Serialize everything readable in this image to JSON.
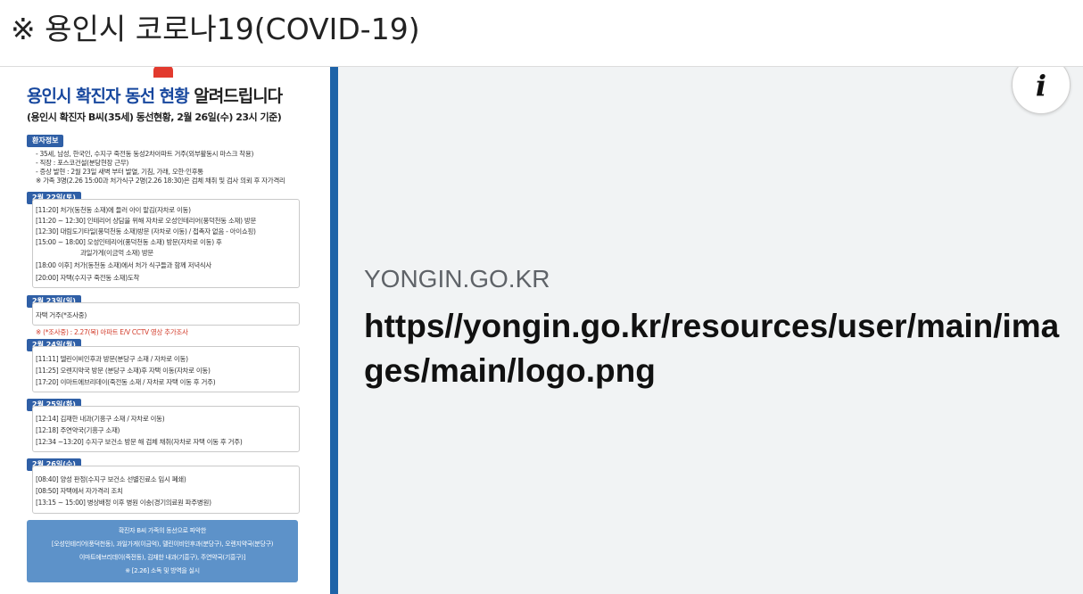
{
  "header": {
    "title": "※ 용인시 코로나19(COVID-19)"
  },
  "card": {
    "domain": "YONGIN.GO.KR",
    "url": "https//yongin.go.kr/resources/user/main/images/main/logo.png",
    "info_icon": "i"
  },
  "poster": {
    "title_blue": "용인시 확진자 동선 현황",
    "title_dark": "알려드립니다",
    "subtitle": "(용인시 확진자 B씨(35세) 동선현황, 2월 26일(수) 23시 기준)",
    "sections": {
      "s0": {
        "head": "환자정보",
        "lines": [
          "- 35세, 남성, 한국인, 수지구 죽전동 동성2차아파트 거주(외부활동시 마스크 착용)",
          "- 직장 : 포스코건설(분당현장 근무)",
          "- 증상 발현 : 2월 23일 새벽 부터 발열, 기침, 가래, 오한·인후통",
          "※ 가족 3명(2.26 15:00과 처가식구 2명(2.26 18:30)은 검체 채취 및 검사 의뢰 후 자가격리"
        ]
      },
      "s1": {
        "head": "2월 22일(토)",
        "lines": [
          "[11:20] 처가(동천동 소재)에 들러 아이 맡김(자차로 이동)",
          "[11:20 ~ 12:30] 인테리어 상담을 위해 자차로 오성인테리어(풍덕천동 소재) 방문",
          "[12:30] 대림도기타일(풍덕천동 소재)방문 (자차로 이동) / 접촉자 없음 - 아이쇼핑)",
          "[15:00 ~ 18:00] 오성인테리어(풍덕천동 소재) 방문(자차로 이동) 후",
          "과일가게(이금억 소재) 방문",
          "[18:00 이후] 처가(동천동 소재)에서 처가 식구들과 함께 저녁식사",
          "[20:00] 자택(수지구 죽전동 소재)도착"
        ]
      },
      "s2": {
        "head": "2월 23일(일)",
        "lines": [
          "자택 거주(*조사중)"
        ],
        "note": "※ (*조사중) : 2.27(목) 아파트 E/V CCTV 영상 추가조사"
      },
      "s3": {
        "head": "2월 24일(월)",
        "lines": [
          "[11:11] 델린이비인후과 방문(분당구 소재 / 자차로 이동)",
          "[11:25] 오렌지약국 방문 (분당구 소재)후 자택 이동(자차로 이동)",
          "[17:20] 이마트에브리데이(죽전동 소재 / 자차로 자택 이동 후 거주)"
        ]
      },
      "s4": {
        "head": "2월 25일(화)",
        "lines": [
          "[12:14] 김재한 내과(기흥구 소재 / 자차로 이동)",
          "[12:18] 주연약국(기흥구 소재)",
          "[12:34 ~13:20] 수지구 보건소 방문 해 검체 채취(자차로 자택 이동 후 거주)"
        ]
      },
      "s5": {
        "head": "2월 26일(수)",
        "lines": [
          "[08:40] 양성 판정(수지구 보건소 선별진료소 임시 폐쇄)",
          "[08:50] 자택에서 자가격리 조치",
          "[13:15 ~ 15:00] 병상배정 이후 병원 이송(경기의료원 파주병원)"
        ]
      }
    },
    "notice": [
      "확진자 B씨 가족의 동선으로 파악한",
      "[오성인테리어(풍덕천동), 과일가게(이금억), 델린이비인후과(분당구), 오렌지약국(분당구)",
      "이마트에브리데이(죽전동), 김재한 내과(기흥구), 주연약국(기흥구)]",
      "※ [2.26] 소독 및 방역을 실시"
    ]
  }
}
